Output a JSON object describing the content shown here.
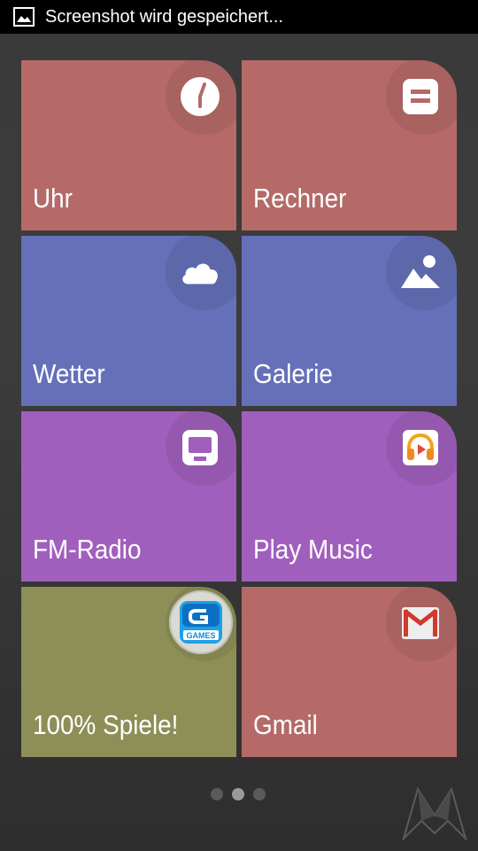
{
  "status_bar": {
    "icon": "image-icon",
    "notification_text": "Screenshot wird gespeichert..."
  },
  "tiles": [
    {
      "label": "Uhr",
      "icon": "clock-icon",
      "color": "#b56a67"
    },
    {
      "label": "Rechner",
      "icon": "calculator-icon",
      "color": "#b56a67"
    },
    {
      "label": "Wetter",
      "icon": "cloud-icon",
      "color": "#6570b9"
    },
    {
      "label": "Galerie",
      "icon": "mountain-image-icon",
      "color": "#6570b9"
    },
    {
      "label": "FM-Radio",
      "icon": "radio-icon",
      "color": "#a15fbd"
    },
    {
      "label": "Play Music",
      "icon": "headphones-icon",
      "color": "#a15fbd"
    },
    {
      "label": "100% Spiele!",
      "icon": "gameloft-games-icon",
      "color": "#8d8f57"
    },
    {
      "label": "Gmail",
      "icon": "gmail-icon",
      "color": "#b56a67"
    }
  ],
  "pager": {
    "pages": 3,
    "current": 2,
    "active_color": "#9a9a9a",
    "inactive_color": "#5a5a5a"
  },
  "watermark": {
    "icon": "logo-watermark-icon"
  }
}
